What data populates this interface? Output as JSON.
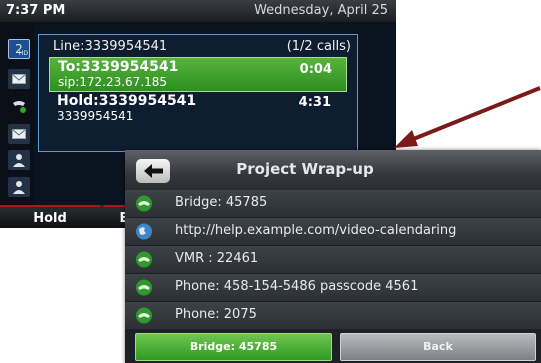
{
  "status": {
    "time": "7:37 PM",
    "date": "Wednesday, April 25"
  },
  "call_panel": {
    "line": "Line:3339954541",
    "call_count": "(1/2 calls)",
    "active_call": {
      "title": "To:3339954541",
      "sip": "sip:172.23.67.185",
      "duration": "0:04"
    },
    "held_call": {
      "title": "Hold:3339954541",
      "number": "3339954541",
      "duration": "4:31"
    }
  },
  "line_key": {
    "label": "2",
    "badge": "HD"
  },
  "softkeys": {
    "hold": "Hold",
    "end": "E"
  },
  "popup": {
    "title": "Project Wrap-up",
    "items": [
      {
        "icon": "phone-icon",
        "label": "Bridge: 45785"
      },
      {
        "icon": "globe-icon",
        "label": "http://help.example.com/video-calendaring"
      },
      {
        "icon": "phone-icon",
        "label": "VMR : 22461"
      },
      {
        "icon": "phone-icon",
        "label": "Phone: 458-154-5486 passcode 4561"
      },
      {
        "icon": "phone-icon",
        "label": "Phone: 2075"
      }
    ],
    "primary_button": "Bridge: 45785",
    "back_button": "Back"
  },
  "colors": {
    "accent_green": "#3aa12a",
    "arrow": "#7a1a1a",
    "panel_border": "#5d9ccc"
  }
}
